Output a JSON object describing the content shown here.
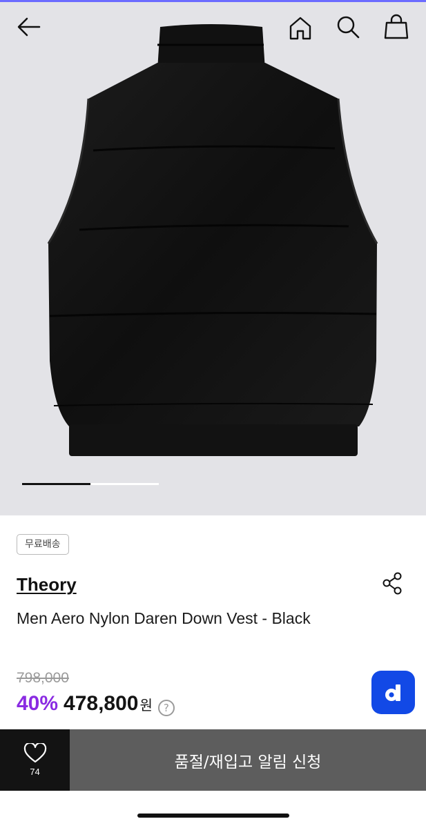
{
  "nav": {
    "back_icon": "arrow-left-icon",
    "home_icon": "home-icon",
    "search_icon": "search-icon",
    "bag_icon": "shopping-bag-icon"
  },
  "gallery": {
    "image": "black quilted down vest, back view",
    "current_slide": 1,
    "progress": 0.5
  },
  "product": {
    "badge": "무료배송",
    "brand": "Theory",
    "title": "Men Aero Nylon Daren Down Vest - Black",
    "original_price": "798,000",
    "discount": "40%",
    "price": "478,800",
    "currency": "원",
    "help_symbol": "?"
  },
  "actions": {
    "share_icon": "share-icon",
    "app_button_label": "d",
    "like_count": "74",
    "notify_label": "품절/재입고 알림 신청"
  },
  "colors": {
    "accent": "#8a2be2",
    "app_button": "#1249e6",
    "notify_bg": "#5d5d5d",
    "like_bg": "#131313"
  }
}
